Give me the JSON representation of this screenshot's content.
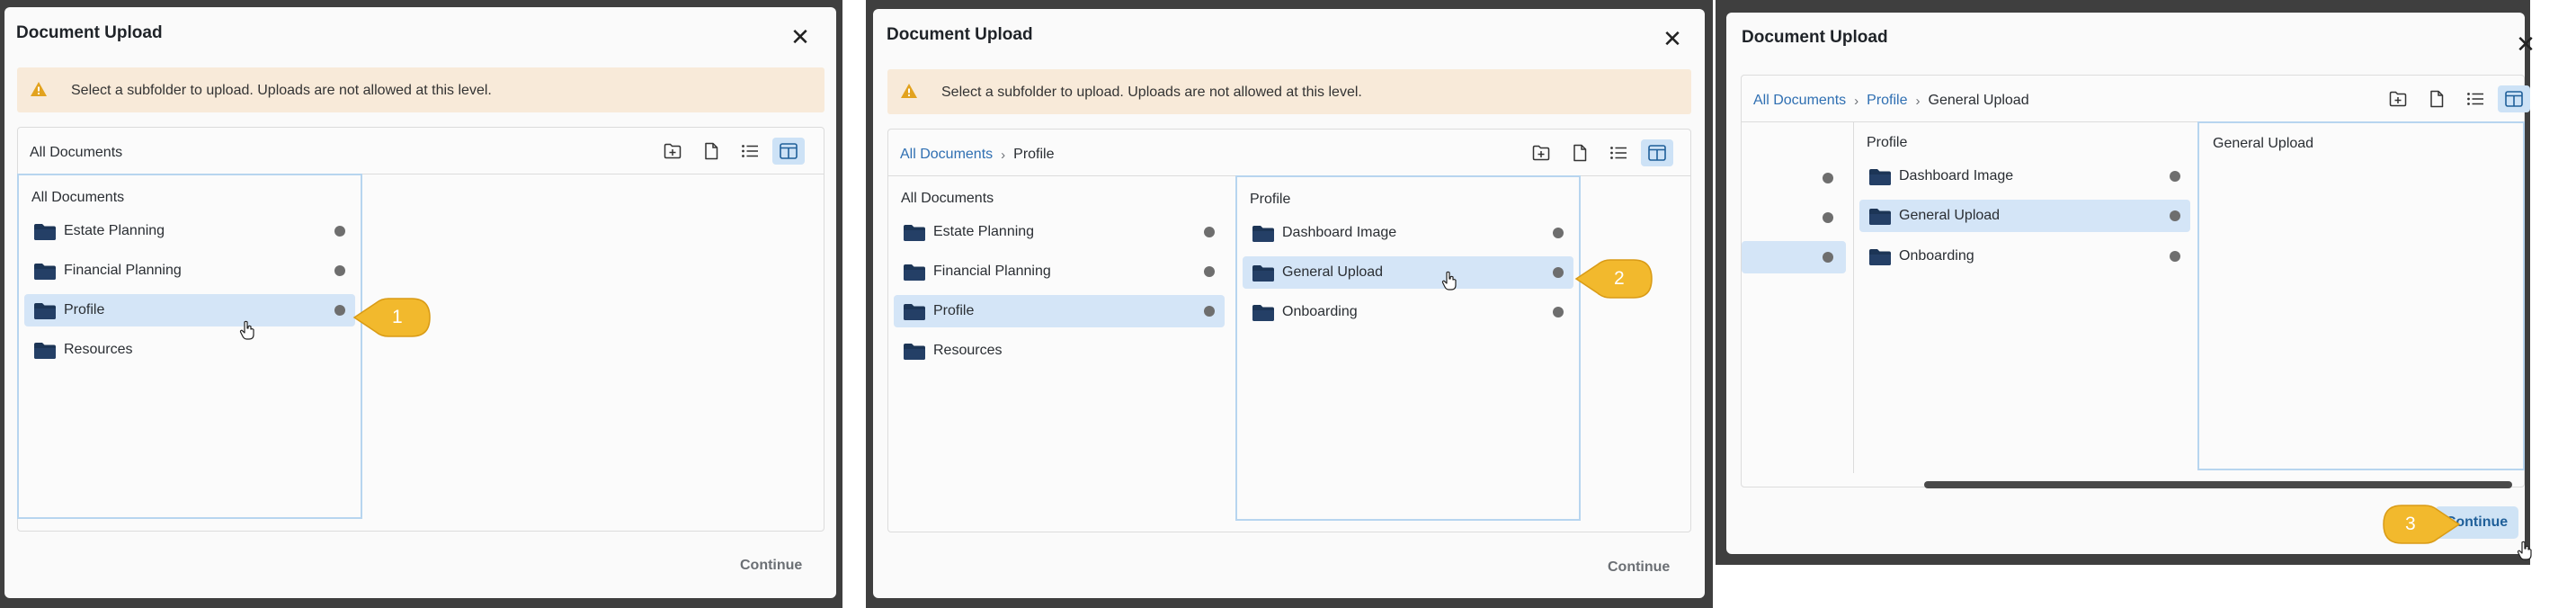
{
  "screens": [
    {
      "title": "Document Upload",
      "close_glyph": "✕",
      "warning": "Select a subfolder to upload. Uploads are not allowed at this level.",
      "breadcrumb": [
        "All Documents"
      ],
      "tools": [
        "new-folder-icon",
        "new-file-icon",
        "list-view-icon",
        "column-view-icon"
      ],
      "columns": [
        {
          "header": "All Documents",
          "items": [
            "Estate Planning",
            "Financial Planning",
            "Profile",
            "Resources"
          ],
          "selected": "Profile"
        }
      ],
      "continue_label": "Continue",
      "callout": "1"
    },
    {
      "title": "Document Upload",
      "close_glyph": "✕",
      "warning": "Select a subfolder to upload. Uploads are not allowed at this level.",
      "breadcrumb": [
        "All Documents",
        "Profile"
      ],
      "tools": [
        "new-folder-icon",
        "new-file-icon",
        "list-view-icon",
        "column-view-icon"
      ],
      "columns": [
        {
          "header": "All Documents",
          "items": [
            "Estate Planning",
            "Financial Planning",
            "Profile",
            "Resources"
          ],
          "selected": "Profile"
        },
        {
          "header": "Profile",
          "items": [
            "Dashboard Image",
            "General Upload",
            "Onboarding"
          ],
          "selected": "General Upload"
        }
      ],
      "continue_label": "Continue",
      "callout": "2"
    },
    {
      "title": "Document Upload",
      "close_glyph": "✕",
      "breadcrumb": [
        "All Documents",
        "Profile",
        "General Upload"
      ],
      "tools": [
        "new-folder-icon",
        "new-file-icon",
        "list-view-icon",
        "column-view-icon"
      ],
      "columns": [
        {
          "header": "Profile",
          "items": [
            "Dashboard Image",
            "General Upload",
            "Onboarding"
          ],
          "selected": "General Upload"
        },
        {
          "header": "General Upload",
          "items": []
        }
      ],
      "continue_label": "Continue",
      "callout": "3"
    }
  ],
  "colors": {
    "accent": "#2f6fb2",
    "selected_row": "#d4e5f7",
    "banner": "#f8ead9",
    "callout": "#f2b92d",
    "folder": "#1c3556"
  }
}
